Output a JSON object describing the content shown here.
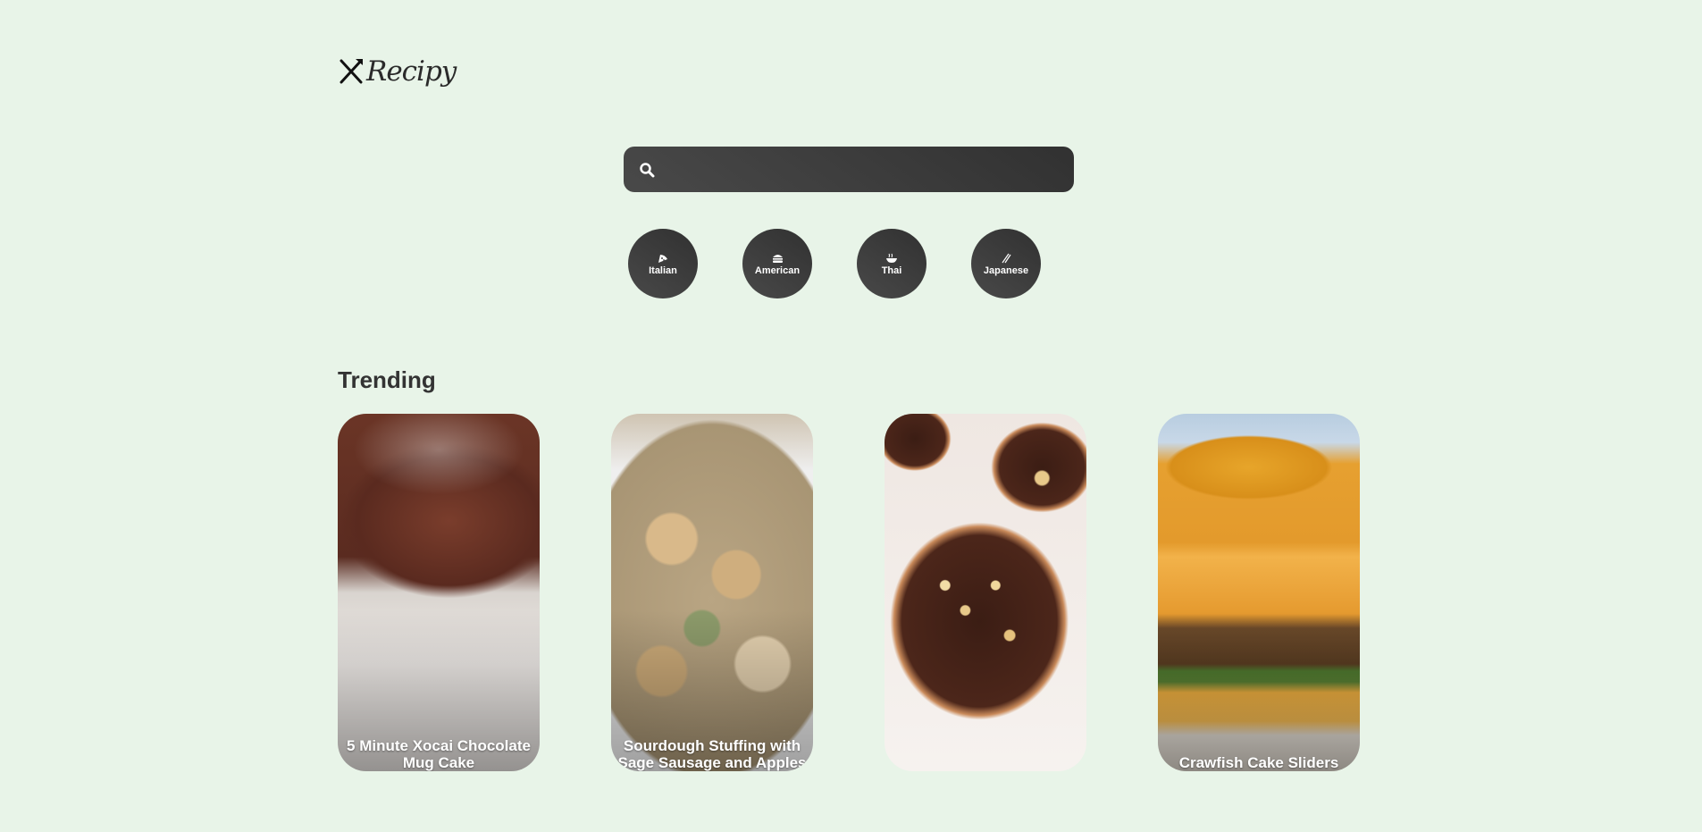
{
  "app": {
    "logo_text": "Recipy"
  },
  "search": {
    "placeholder": "",
    "value": ""
  },
  "cuisines": [
    {
      "label": "Italian",
      "icon": "pizza-icon"
    },
    {
      "label": "American",
      "icon": "hamburger-icon"
    },
    {
      "label": "Thai",
      "icon": "noodle-bowl-icon"
    },
    {
      "label": "Japanese",
      "icon": "chopsticks-icon"
    }
  ],
  "trending": {
    "title": "Trending",
    "cards": [
      {
        "title_line1": "5 Minute Xocai Chocolate",
        "title_line2": "Mug Cake"
      },
      {
        "title_line1": "Sourdough Stuffing with",
        "title_line2": "Sage Sausage and Apples"
      },
      {
        "title_line1": "",
        "title_line2": ""
      },
      {
        "title_line1": "",
        "title_line2": "Crawfish Cake Sliders"
      }
    ]
  },
  "colors": {
    "background": "#e8f4e8",
    "dark": "#3a3a3a"
  }
}
